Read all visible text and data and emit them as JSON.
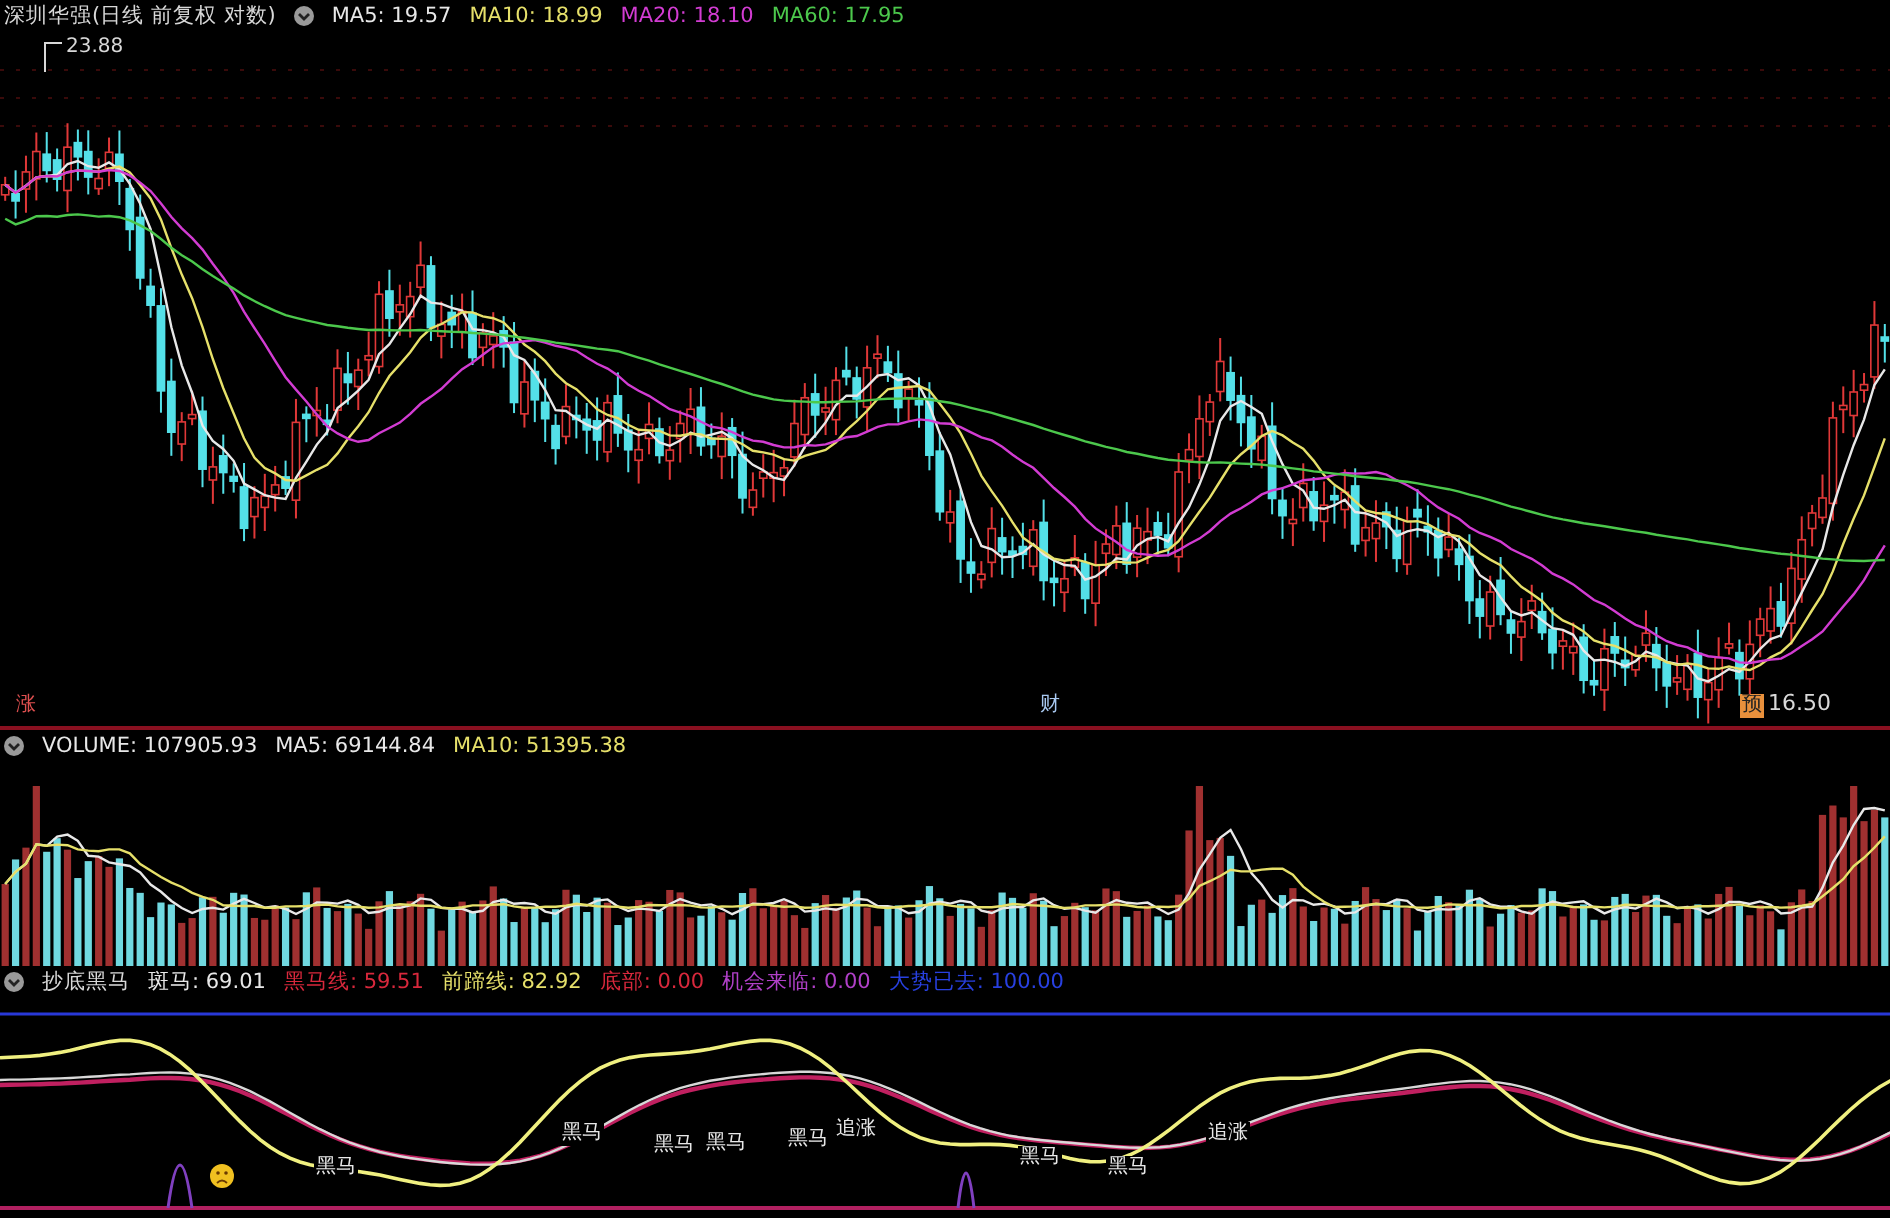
{
  "price_panel": {
    "title": "深圳华强(日线 前复权 对数)",
    "legend": [
      {
        "label": "MA5: 19.57",
        "color": "#e8e8e8"
      },
      {
        "label": "MA10: 18.99",
        "color": "#e6e06a"
      },
      {
        "label": "MA20: 18.10",
        "color": "#d23cd2"
      },
      {
        "label": "MA60: 17.95",
        "color": "#4cc84c"
      }
    ],
    "high_label": "23.88",
    "low_label": "16.50",
    "markers": [
      {
        "text": "涨",
        "kind": "plain",
        "color": "#e05050"
      },
      {
        "text": "财",
        "kind": "plain",
        "color": "#a8c8f0"
      },
      {
        "text": "预",
        "kind": "badge",
        "color": "#e8903c"
      }
    ]
  },
  "volume_panel": {
    "legend": [
      {
        "label": "VOLUME: 107905.93",
        "color": "#e8e8e8"
      },
      {
        "label": "MA5: 69144.84",
        "color": "#e8e8e8"
      },
      {
        "label": "MA10: 51395.38",
        "color": "#e6e06a"
      }
    ]
  },
  "indicator_panel": {
    "title": "抄底黑马",
    "legend": [
      {
        "label": "斑马: 69.01",
        "color": "#e8e8e8"
      },
      {
        "label": "黑马线: 59.51",
        "color": "#d8283c"
      },
      {
        "label": "前蹄线: 82.92",
        "color": "#e6e06a"
      },
      {
        "label": "底部: 0.00",
        "color": "#d8283c"
      },
      {
        "label": "机会来临: 0.00",
        "color": "#b040c8"
      },
      {
        "label": "大势已去: 100.00",
        "color": "#2840e0"
      }
    ],
    "annotations": [
      "黑马",
      "黑马",
      "黑马",
      "黑马",
      "黑马",
      "追涨",
      "黑马",
      "黑马",
      "追涨"
    ]
  }
}
